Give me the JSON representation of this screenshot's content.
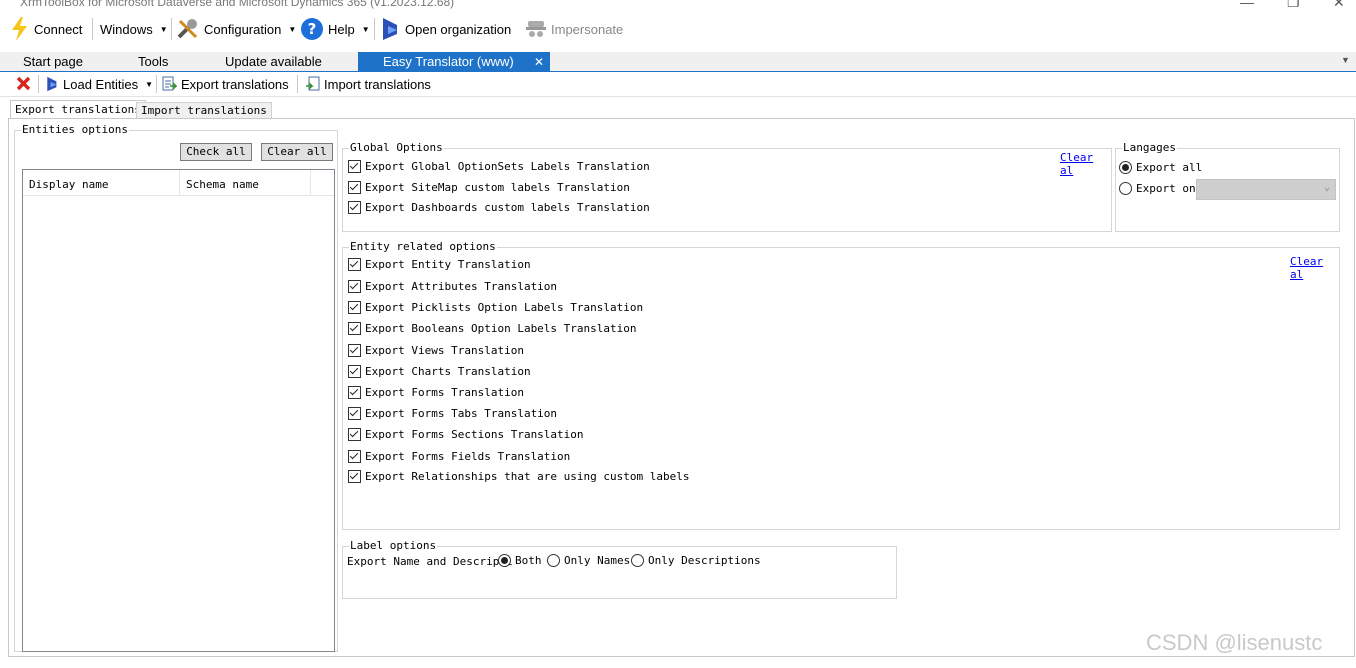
{
  "window": {
    "title": "XrmToolBox for Microsoft Dataverse and Microsoft Dynamics 365 (v1.2023.12.68)"
  },
  "toolbar": {
    "connect": "Connect",
    "windows": "Windows",
    "configuration": "Configuration",
    "help": "Help",
    "open_organization": "Open organization",
    "impersonate": "Impersonate"
  },
  "tabs": [
    {
      "label": "Start page"
    },
    {
      "label": "Tools"
    },
    {
      "label": "Update available"
    },
    {
      "label": "Easy Translator (www)"
    }
  ],
  "plugin_toolbar": {
    "load_entities": "Load Entities",
    "export_translations": "Export translations",
    "import_translations": "Import translations"
  },
  "inner_tabs": [
    "Export translations",
    "Import translations"
  ],
  "entities_options": {
    "title": "Entities options",
    "check_all": "Check all",
    "clear_all": "Clear all",
    "columns": [
      "Display name",
      "Schema name"
    ]
  },
  "global_options": {
    "title": "Global Options",
    "clear_link": "Clear al",
    "items": [
      "Export Global OptionSets Labels Translation",
      "Export SiteMap custom labels Translation",
      "Export Dashboards custom labels Translation"
    ]
  },
  "languages": {
    "title": "Langages",
    "export_all": "Export all",
    "export_only": "Export onl"
  },
  "entity_options": {
    "title": "Entity related options",
    "clear_link": "Clear al",
    "items": [
      "Export Entity Translation",
      "Export Attributes Translation",
      "Export Picklists Option Labels Translation",
      "Export Booleans Option Labels Translation",
      "Export Views Translation",
      "Export Charts Translation",
      "Export Forms Translation",
      "Export Forms Tabs Translation",
      "Export Forms Sections Translation",
      "Export Forms Fields Translation",
      "Export Relationships that are using custom labels"
    ]
  },
  "label_options": {
    "title": "Label options",
    "export_label": "Export Name and Descripti",
    "both": "Both",
    "only_names": "Only Names",
    "only_descriptions": "Only Descriptions"
  },
  "watermark": "CSDN @lisenustc"
}
